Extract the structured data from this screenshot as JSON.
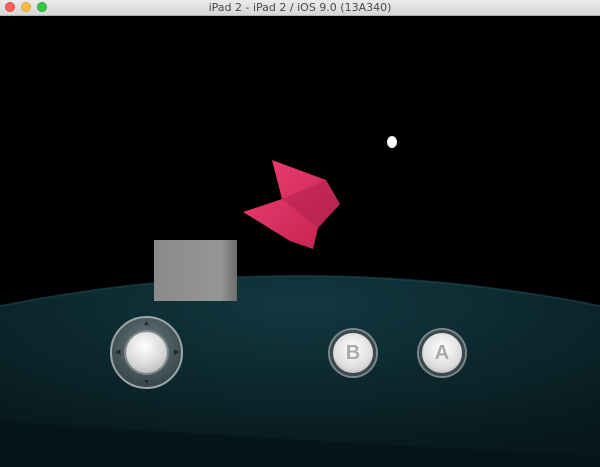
{
  "window": {
    "title": "iPad 2 - iPad 2 / iOS 9.0 (13A340)"
  },
  "controls": {
    "dpad_arrows": [
      "▲",
      "▼",
      "◀",
      "▶"
    ],
    "button_b_label": "B",
    "button_a_label": "A"
  },
  "colors": {
    "floor": "#0c2a30",
    "cube": "#8e8e8e",
    "ribbon": "#e8336c",
    "light": "#ffffff"
  }
}
